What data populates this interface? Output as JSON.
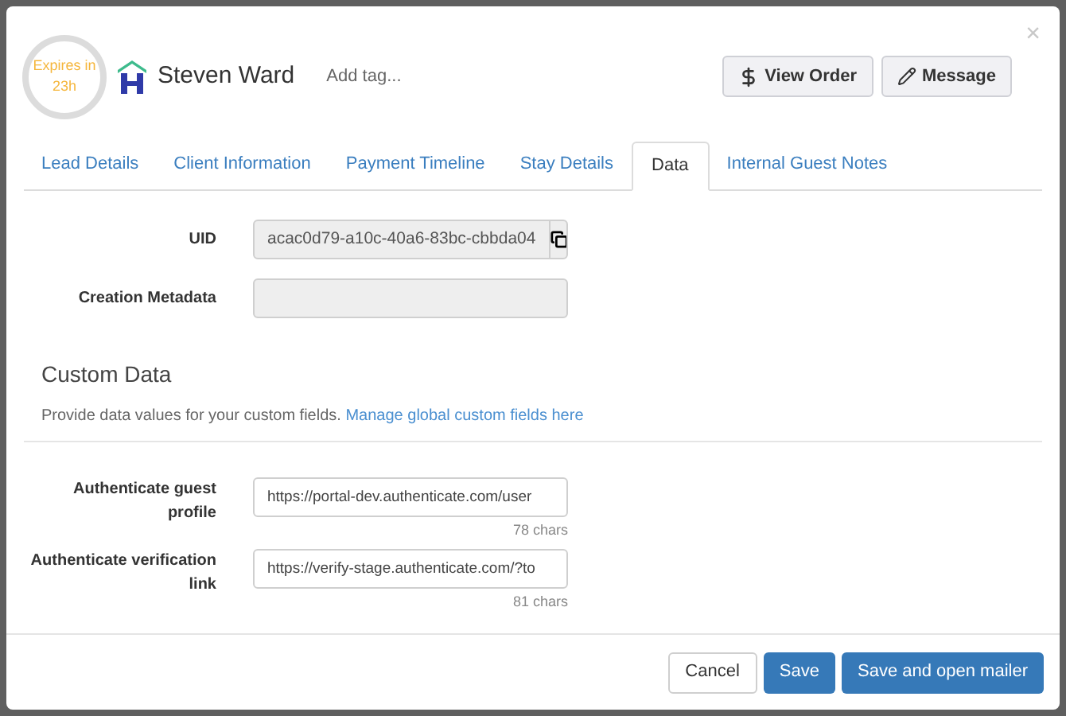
{
  "header": {
    "timer": {
      "line1": "Expires in",
      "line2": "23h"
    },
    "name": "Steven Ward",
    "tag_placeholder": "Add tag...",
    "buttons": [
      {
        "kind": "order",
        "label": "View Order"
      },
      {
        "kind": "message",
        "label": "Message"
      }
    ],
    "close": "×"
  },
  "tabs": [
    {
      "label": "Lead Details",
      "selected": false
    },
    {
      "label": "Client Information",
      "selected": false
    },
    {
      "label": "Payment Timeline",
      "selected": false
    },
    {
      "label": "Stay Details",
      "selected": false
    },
    {
      "label": "Data",
      "selected": true
    },
    {
      "label": "Internal Guest Notes",
      "selected": false
    }
  ],
  "fields": [
    {
      "label": "UID",
      "value": "acac0d79-a10c-40a6-83bc-cbbda04",
      "kind": "copy"
    },
    {
      "label": "Creation Metadata",
      "kind": "readonly"
    }
  ],
  "custom_data": {
    "title": "Custom Data",
    "description": "Provide data values for your custom fields.",
    "link": "Manage global custom fields here",
    "fields": [
      {
        "label": "Authenticate guest profile",
        "value": "https://portal-dev.authenticate.com/user",
        "count": "78 chars"
      },
      {
        "label": "Authenticate verification link",
        "value": "https://verify-stage.authenticate.com/?to",
        "count": "81 chars"
      }
    ]
  },
  "footer": {
    "buttons": [
      {
        "kind": "default",
        "label": "Cancel"
      },
      {
        "kind": "primary",
        "label": "Save"
      },
      {
        "kind": "primary",
        "label": "Save and open mailer"
      }
    ]
  }
}
